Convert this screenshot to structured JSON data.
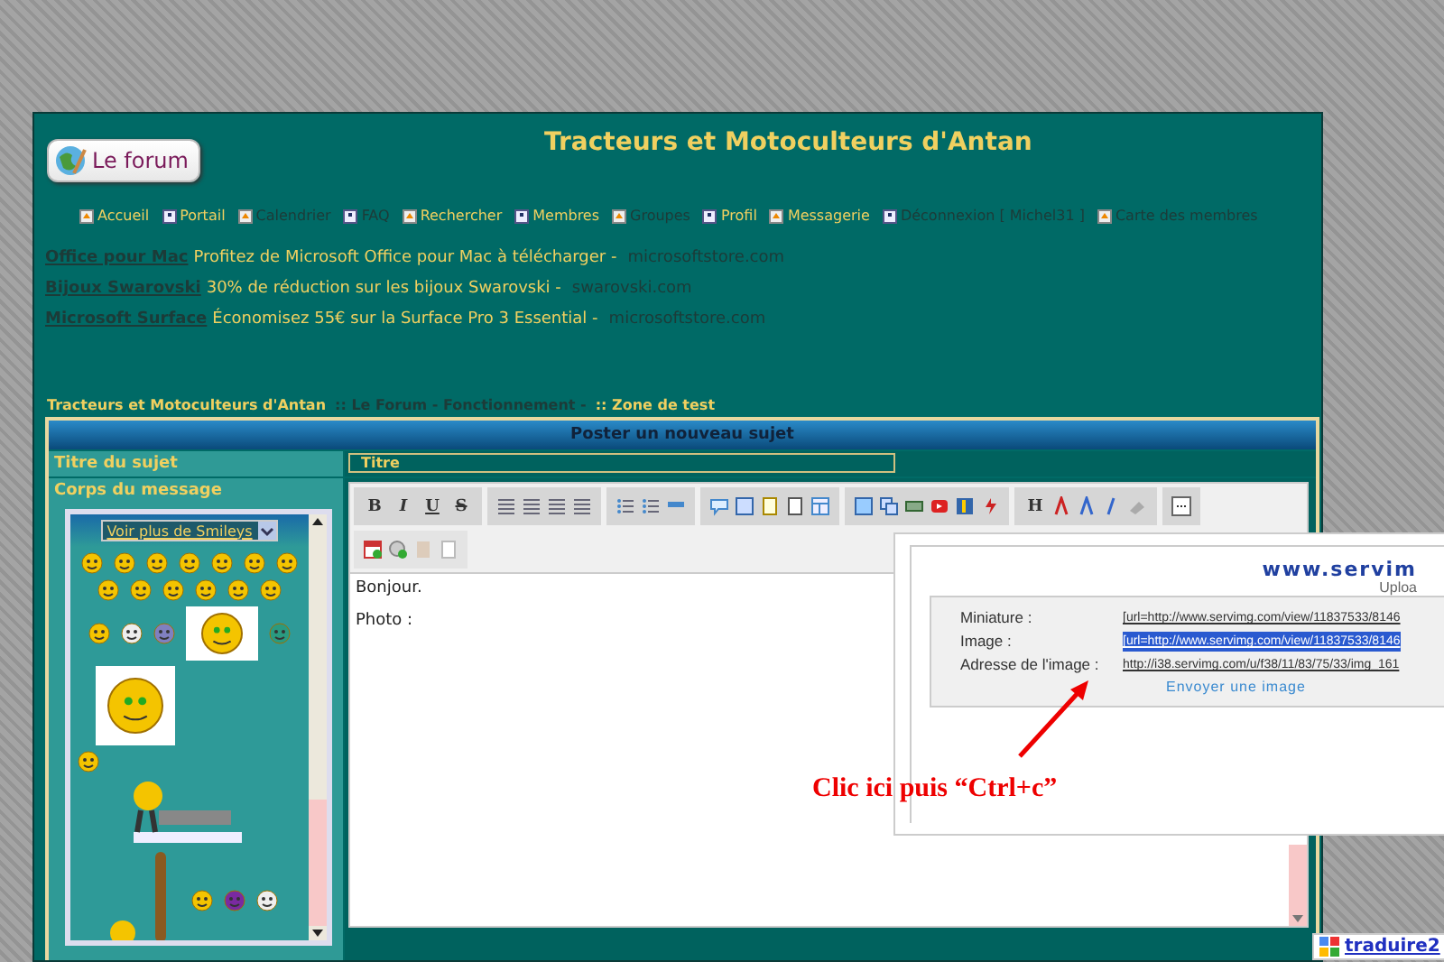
{
  "site": {
    "logo_label": "Le forum",
    "title": "Tracteurs et Motoculteurs d'Antan"
  },
  "nav": [
    {
      "label": "Accueil",
      "visited": false
    },
    {
      "label": "Portail",
      "visited": false
    },
    {
      "label": "Calendrier",
      "visited": true
    },
    {
      "label": "FAQ",
      "visited": true
    },
    {
      "label": "Rechercher",
      "visited": false
    },
    {
      "label": "Membres",
      "visited": false
    },
    {
      "label": "Groupes",
      "visited": true
    },
    {
      "label": "Profil",
      "visited": false
    },
    {
      "label": "Messagerie",
      "visited": false
    },
    {
      "label": "Déconnexion [ Michel31 ]",
      "visited": true
    },
    {
      "label": "Carte des membres",
      "visited": true
    }
  ],
  "ads": [
    {
      "link": "Office pour Mac",
      "text": "Profitez de Microsoft Office pour Mac à télécharger -",
      "domain": "microsoftstore.com"
    },
    {
      "link": "Bijoux Swarovski",
      "text": "30% de réduction sur les bijoux Swarovski -",
      "domain": "swarovski.com"
    },
    {
      "link": "Microsoft Surface",
      "text": "Économisez 55€ sur la Surface Pro 3 Essential -",
      "domain": "microsoftstore.com"
    }
  ],
  "breadcrumb": [
    {
      "label": "Tracteurs et Motoculteurs d'Antan",
      "visited": false
    },
    {
      "label": ":: Le Forum - Fonctionnement -",
      "visited": true
    },
    {
      "label": ":: Zone de test",
      "visited": false
    }
  ],
  "form": {
    "header": "Poster un nouveau sujet",
    "subject_label": "Titre du sujet",
    "subject_value": "Titre",
    "body_label": "Corps du message",
    "smiley_select": "Voir plus de Smileys",
    "toolbar_text": [
      "B",
      "I",
      "U",
      "S",
      "H"
    ],
    "editor_lines": [
      "Bonjour.",
      "Photo :"
    ]
  },
  "popup": {
    "logo": "www.servim",
    "logo_sub": "Uploa",
    "rows": [
      {
        "label": "Miniature :",
        "value": "[url=http://www.servimg.com/view/11837533/8146",
        "selected": false
      },
      {
        "label": "Image :",
        "value": "[url=http://www.servimg.com/view/11837533/8146",
        "selected": true
      },
      {
        "label": "Adresse de l'image :",
        "value": "http://i38.servimg.com/u/f38/11/83/75/33/img_161",
        "selected": false
      }
    ],
    "send_link": "Envoyer une image"
  },
  "annotation": "Clic ici puis “Ctrl+c”",
  "translate": "traduire2"
}
